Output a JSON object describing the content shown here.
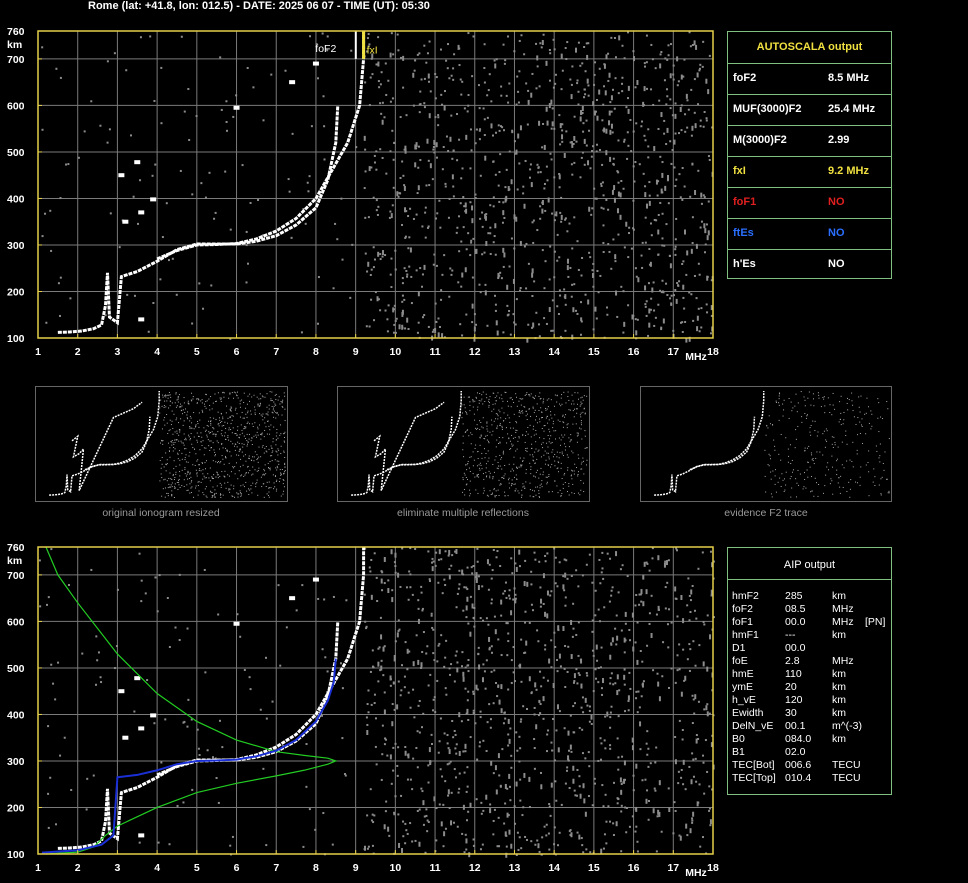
{
  "header": {
    "text": "Rome (lat: +41.8, lon: 012.5) - DATE: 2025 06 07 - TIME (UT): 05:30"
  },
  "colors": {
    "axis": "#e6d04a",
    "grid": "#7a7a7a",
    "trace": "#ffffff",
    "noise": "#8c8c8c",
    "profile": "#22cc22",
    "fit": "#1a2fd6",
    "panel_border": "#7fbf7f",
    "yellow": "#f0e040",
    "red": "#e02020",
    "blue": "#2a6fff"
  },
  "axes": {
    "x_ticks": [
      "1",
      "2",
      "3",
      "4",
      "5",
      "6",
      "7",
      "8",
      "9",
      "10",
      "11",
      "12",
      "13",
      "14",
      "15",
      "16",
      "17",
      "18"
    ],
    "y_ticks": [
      "760",
      "700",
      "600",
      "500",
      "400",
      "300",
      "200",
      "100"
    ],
    "x_unit": "MHz",
    "y_unit": "km",
    "xlim": [
      1,
      18
    ],
    "ylim": [
      100,
      760
    ]
  },
  "chart_data": [
    {
      "type": "scatter",
      "x_ticks": [
        1,
        2,
        3,
        4,
        5,
        6,
        7,
        8,
        9,
        10,
        11,
        12,
        13,
        14,
        15,
        16,
        17,
        18
      ],
      "y_ticks": [
        760,
        700,
        600,
        500,
        400,
        300,
        200,
        100
      ],
      "xlabel": "MHz",
      "ylabel": "km",
      "xlim": [
        1,
        18
      ],
      "ylim": [
        100,
        760
      ],
      "annotations": [
        {
          "label": "foF2",
          "x": 8.5
        },
        {
          "label": "fxI",
          "x": 9.2
        }
      ],
      "series": [
        {
          "values": [
            [
              1.5,
              112
            ],
            [
              1.8,
              113
            ],
            [
              2.1,
              115
            ],
            [
              2.4,
              120
            ],
            [
              2.6,
              128
            ],
            [
              2.7,
              170
            ],
            [
              2.75,
              240
            ],
            [
              2.8,
              145
            ],
            [
              3.0,
              133
            ],
            [
              3.1,
              232
            ],
            [
              3.5,
              243
            ],
            [
              4.0,
              265
            ],
            [
              4.5,
              290
            ],
            [
              5.0,
              302
            ],
            [
              5.5,
              302
            ],
            [
              6.0,
              302
            ],
            [
              6.5,
              308
            ],
            [
              7.0,
              320
            ],
            [
              7.5,
              343
            ],
            [
              8.0,
              380
            ],
            [
              8.3,
              440
            ],
            [
              8.5,
              520
            ],
            [
              8.55,
              600
            ]
          ]
        },
        {
          "values": [
            [
              4.0,
              270
            ],
            [
              4.5,
              288
            ],
            [
              5.0,
              300
            ],
            [
              5.5,
              301
            ],
            [
              6.0,
              303
            ],
            [
              6.5,
              313
            ],
            [
              7.0,
              330
            ],
            [
              7.5,
              357
            ],
            [
              8.0,
              400
            ],
            [
              8.4,
              460
            ],
            [
              8.8,
              520
            ],
            [
              9.1,
              600
            ],
            [
              9.2,
              700
            ],
            [
              9.2,
              760
            ]
          ]
        },
        {
          "values": [
            [
              3.1,
              450
            ],
            [
              3.5,
              478
            ],
            [
              3.2,
              350
            ],
            [
              3.6,
              370
            ],
            [
              3.9,
              398
            ],
            [
              3.6,
              140
            ],
            [
              6.0,
              595
            ],
            [
              7.4,
              650
            ],
            [
              8.0,
              690
            ]
          ]
        }
      ]
    },
    {
      "type": "line",
      "xlim": [
        1,
        18
      ],
      "ylim": [
        100,
        760
      ],
      "series": [
        {
          "values": [
            [
              1.2,
              760
            ],
            [
              1.5,
              700
            ],
            [
              2.0,
              640
            ],
            [
              3.0,
              530
            ],
            [
              4.0,
              445
            ],
            [
              5.0,
              385
            ],
            [
              6.0,
              345
            ],
            [
              7.0,
              320
            ],
            [
              7.7,
              312
            ],
            [
              8.3,
              306
            ],
            [
              8.5,
              300
            ],
            [
              8.3,
              293
            ],
            [
              7.7,
              280
            ],
            [
              7.0,
              268
            ],
            [
              6.0,
              252
            ],
            [
              5.0,
              232
            ],
            [
              4.0,
              200
            ],
            [
              3.0,
              160
            ],
            [
              2.7,
              140
            ],
            [
              2.4,
              115
            ],
            [
              2.0,
              104
            ],
            [
              1.2,
              100
            ]
          ]
        },
        {
          "values": [
            [
              1.1,
              103
            ],
            [
              2.0,
              108
            ],
            [
              2.6,
              120
            ],
            [
              2.9,
              140
            ],
            [
              3.0,
              265
            ],
            [
              3.5,
              270
            ],
            [
              4.0,
              280
            ],
            [
              4.5,
              293
            ],
            [
              5.0,
              300
            ],
            [
              5.5,
              301
            ],
            [
              6.0,
              303
            ],
            [
              6.5,
              310
            ],
            [
              7.0,
              322
            ],
            [
              7.5,
              345
            ],
            [
              8.0,
              385
            ],
            [
              8.3,
              430
            ],
            [
              8.45,
              470
            ],
            [
              8.5,
              520
            ]
          ]
        }
      ]
    }
  ],
  "autoscala": {
    "title": "AUTOSCALA output",
    "rows": [
      {
        "label": "foF2",
        "value": "8.5 MHz",
        "color": "#ffffff"
      },
      {
        "label": "MUF(3000)F2",
        "value": "25.4 MHz",
        "color": "#ffffff"
      },
      {
        "label": "M(3000)F2",
        "value": "2.99",
        "color": "#ffffff"
      },
      {
        "label": "fxI",
        "value": "9.2 MHz",
        "color": "#f0e040"
      },
      {
        "label": "foF1",
        "value": "NO",
        "color": "#e02020"
      },
      {
        "label": "ftEs",
        "value": "NO",
        "color": "#2a6fff"
      },
      {
        "label": "h'Es",
        "value": "NO",
        "color": "#ffffff"
      }
    ]
  },
  "thumbnails": [
    {
      "caption": "original ionogram resized"
    },
    {
      "caption": "eliminate multiple reflections"
    },
    {
      "caption": "evidence F2 trace"
    }
  ],
  "aip": {
    "title": "AIP output",
    "rows": [
      {
        "name": "hmF2",
        "value": "285",
        "unit": "km",
        "extra": ""
      },
      {
        "name": "foF2",
        "value": "08.5",
        "unit": "MHz",
        "extra": ""
      },
      {
        "name": "foF1",
        "value": "00.0",
        "unit": "MHz",
        "extra": "[PN]"
      },
      {
        "name": "hmF1",
        "value": "---",
        "unit": "km",
        "extra": ""
      },
      {
        "name": "D1",
        "value": "00.0",
        "unit": "",
        "extra": ""
      },
      {
        "name": "foE",
        "value": "2.8",
        "unit": "MHz",
        "extra": ""
      },
      {
        "name": "hmE",
        "value": "110",
        "unit": "km",
        "extra": ""
      },
      {
        "name": "ymE",
        "value": "20",
        "unit": "km",
        "extra": ""
      },
      {
        "name": "h_vE",
        "value": "120",
        "unit": "km",
        "extra": ""
      },
      {
        "name": "Ewidth",
        "value": "30",
        "unit": "km",
        "extra": ""
      },
      {
        "name": "DelN_vE",
        "value": "00.1",
        "unit": "m^(-3)",
        "extra": ""
      },
      {
        "name": "B0",
        "value": "084.0",
        "unit": "km",
        "extra": ""
      },
      {
        "name": "B1",
        "value": "02.0",
        "unit": "",
        "extra": ""
      },
      {
        "name": "TEC[Bot]",
        "value": "006.6",
        "unit": "TECU",
        "extra": ""
      },
      {
        "name": "TEC[Top]",
        "value": "010.4",
        "unit": "TECU",
        "extra": ""
      }
    ]
  }
}
